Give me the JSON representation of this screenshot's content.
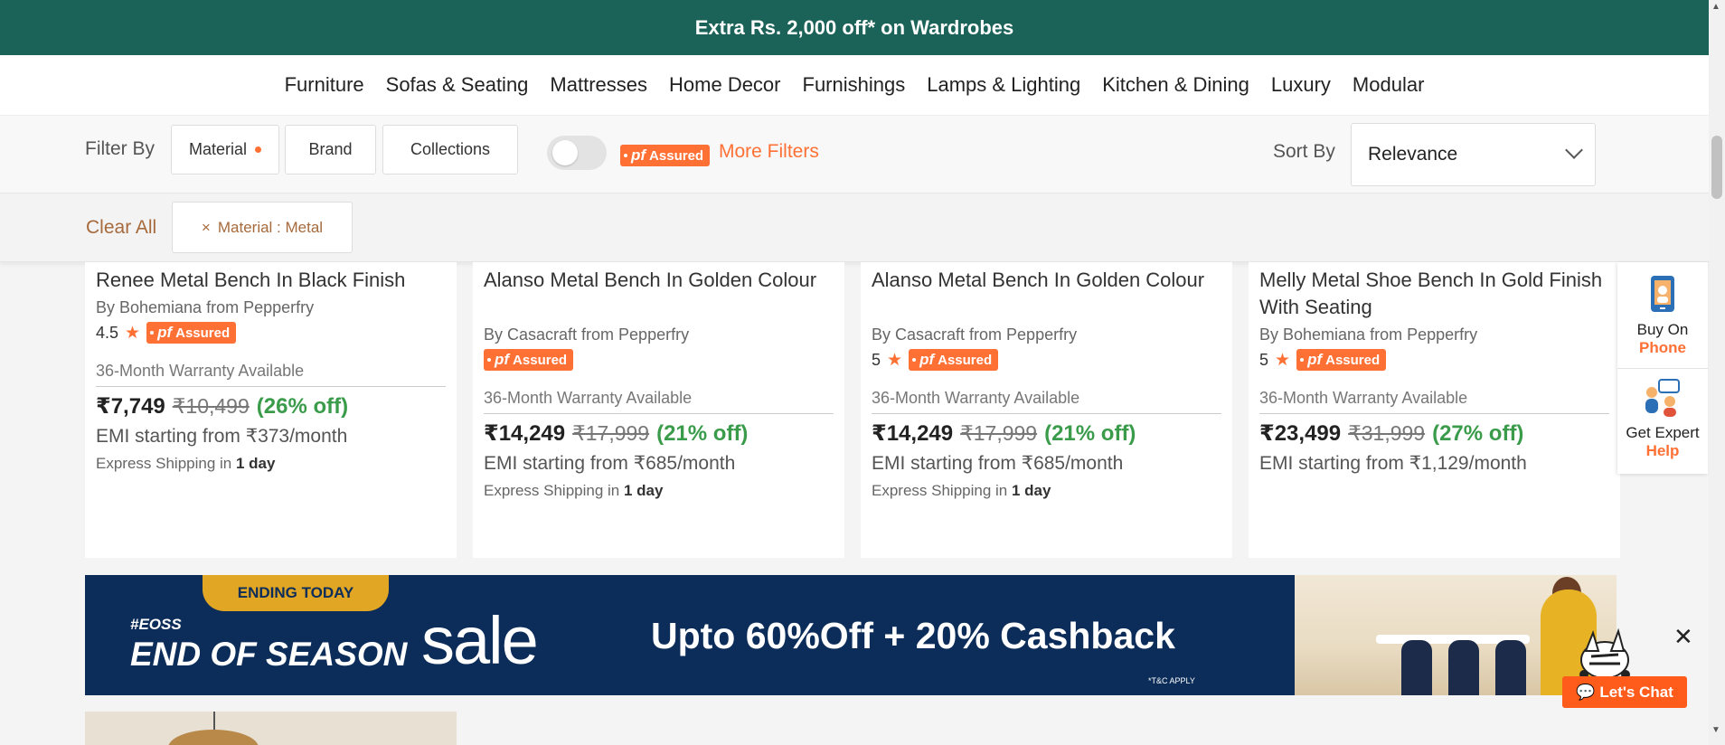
{
  "topbar": {
    "text": "Extra Rs. 2,000 off* on Wardrobes"
  },
  "nav": {
    "items": [
      "Furniture",
      "Sofas & Seating",
      "Mattresses",
      "Home Decor",
      "Furnishings",
      "Lamps & Lighting",
      "Kitchen & Dining",
      "Luxury",
      "Modular"
    ]
  },
  "filters": {
    "label": "Filter By",
    "buttons": [
      "Material",
      "Brand",
      "Collections"
    ],
    "pf_text": "pf",
    "pf_assured": "Assured",
    "more_filters": "More Filters",
    "sort_label": "Sort By",
    "sort_value": "Relevance"
  },
  "applied": {
    "clear_all": "Clear All",
    "chip_label": "Material : Metal",
    "chip_close": "×"
  },
  "products": [
    {
      "title": "Renee Metal Bench In Black Finish",
      "brand": "By Bohemiana from Pepperfry",
      "rating": "4.5",
      "warranty": "36-Month Warranty Available",
      "price": "₹7,749",
      "mrp": "₹10,499",
      "off": "(26% off)",
      "emi": "EMI starting from ₹373/month",
      "ship_prefix": "Express Shipping in",
      "ship_days": "1 day"
    },
    {
      "title": "Alanso Metal Bench In Golden Colour",
      "brand": "By Casacraft from Pepperfry",
      "rating": "",
      "warranty": "36-Month Warranty Available",
      "price": "₹14,249",
      "mrp": "₹17,999",
      "off": "(21% off)",
      "emi": "EMI starting from ₹685/month",
      "ship_prefix": "Express Shipping in",
      "ship_days": "1 day"
    },
    {
      "title": "Alanso Metal Bench In Golden Colour",
      "brand": "By Casacraft from Pepperfry",
      "rating": "5",
      "warranty": "36-Month Warranty Available",
      "price": "₹14,249",
      "mrp": "₹17,999",
      "off": "(21% off)",
      "emi": "EMI starting from ₹685/month",
      "ship_prefix": "Express Shipping in",
      "ship_days": "1 day"
    },
    {
      "title": "Melly Metal Shoe Bench In Gold Finish With Seating",
      "brand": "By Bohemiana from Pepperfry",
      "rating": "5",
      "warranty": "36-Month Warranty Available",
      "price": "₹23,499",
      "mrp": "₹31,999",
      "off": "(27% off)",
      "emi": "EMI starting from ₹1,129/month",
      "ship_prefix": "",
      "ship_days": ""
    }
  ],
  "side_panel": {
    "buy_on": "Buy On",
    "phone": "Phone",
    "get_expert": "Get Expert",
    "help": "Help"
  },
  "banner": {
    "ending_today": "ENDING TODAY",
    "hashtag": "#EOSS",
    "end_of_season": "END OF SEASON",
    "sale": "sale",
    "offer": "Upto 60%Off + 20% Cashback",
    "tc": "*T&C APPLY",
    "close": "✕"
  },
  "chat": {
    "label": "Let's Chat"
  },
  "colors": {
    "brand_green": "#1b6359",
    "accent_orange": "#ff7035",
    "discount_green": "#3a9c4b",
    "banner_navy": "#0c2d59"
  }
}
